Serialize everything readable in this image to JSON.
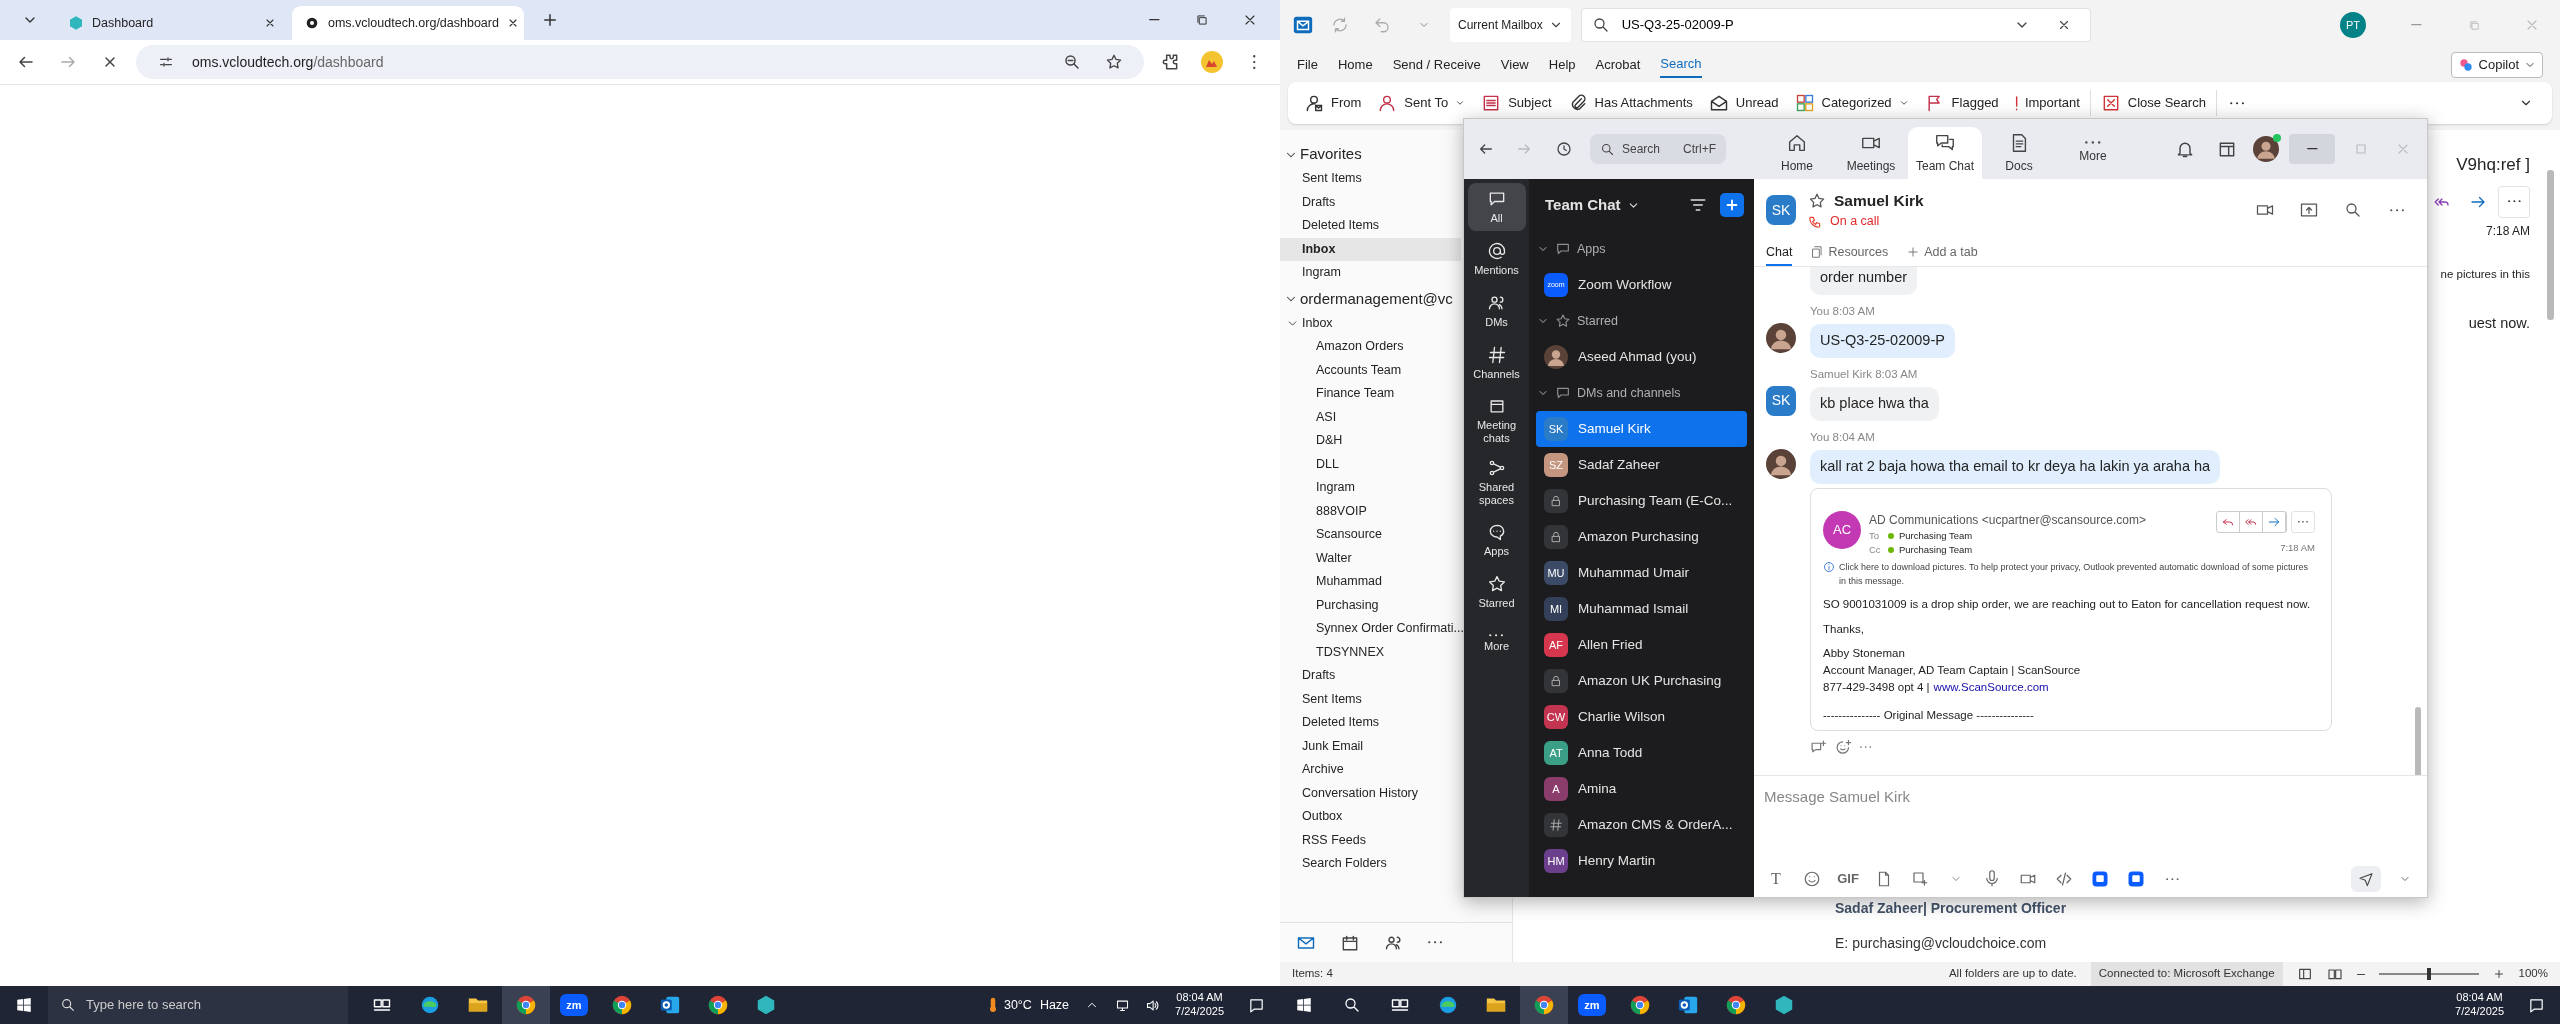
{
  "chrome": {
    "tabs": [
      {
        "title": "Dashboard",
        "kind": "app",
        "selected": false
      },
      {
        "title": "oms.vcloudtech.org/dashboard",
        "kind": "site",
        "selected": true
      }
    ],
    "url_host": "oms.vcloudtech.org",
    "url_path": "/dashboard"
  },
  "outlook": {
    "scope": "Current Mailbox",
    "search_value": "US-Q3-25-02009-P",
    "avatar": "PT",
    "menu": [
      {
        "label": "File",
        "selected": false
      },
      {
        "label": "Home",
        "selected": false
      },
      {
        "label": "Send / Receive",
        "selected": false
      },
      {
        "label": "View",
        "selected": false
      },
      {
        "label": "Help",
        "selected": false
      },
      {
        "label": "Acrobat",
        "selected": false
      },
      {
        "label": "Search",
        "selected": true
      }
    ],
    "copilot": "Copilot",
    "ribbon": [
      {
        "kind": "from",
        "label": "From",
        "dropdown": false
      },
      {
        "kind": "sent-to",
        "label": "Sent To",
        "dropdown": true
      },
      {
        "kind": "subject",
        "label": "Subject",
        "dropdown": false
      },
      {
        "kind": "attachments",
        "label": "Has Attachments",
        "dropdown": false
      },
      {
        "kind": "unread",
        "label": "Unread",
        "dropdown": false
      },
      {
        "kind": "categorized",
        "label": "Categorized",
        "dropdown": true
      },
      {
        "kind": "flagged",
        "label": "Flagged",
        "dropdown": false
      },
      {
        "kind": "important",
        "label": "Important",
        "dropdown": false
      },
      {
        "kind": "close-search",
        "label": "Close Search",
        "dropdown": false
      }
    ],
    "folders": [
      {
        "label": "Favorites",
        "expanded": true,
        "children": [
          {
            "label": "Sent Items",
            "selected": false
          },
          {
            "label": "Drafts",
            "selected": false
          },
          {
            "label": "Deleted Items",
            "selected": false
          },
          {
            "label": "Inbox",
            "selected": true
          },
          {
            "label": "Ingram",
            "selected": false
          }
        ]
      },
      {
        "label": "ordermanagement@vc",
        "expanded": true,
        "children": [
          {
            "label": "Inbox",
            "selected": false,
            "expanded": true,
            "children": [
              {
                "label": "Amazon Orders",
                "selected": false
              },
              {
                "label": "Accounts Team",
                "selected": false
              },
              {
                "label": "Finance Team",
                "selected": false
              },
              {
                "label": "ASI",
                "selected": false
              },
              {
                "label": "D&H",
                "selected": false
              },
              {
                "label": "DLL",
                "selected": false
              },
              {
                "label": "Ingram",
                "selected": false
              },
              {
                "label": "888VOIP",
                "selected": false
              },
              {
                "label": "Scansource",
                "selected": false
              },
              {
                "label": "Walter",
                "selected": false
              },
              {
                "label": "Muhammad",
                "selected": false
              },
              {
                "label": "Purchasing",
                "selected": false
              },
              {
                "label": "Synnex Order Confirmati...",
                "selected": false
              },
              {
                "label": "TDSYNNEX",
                "selected": false
              }
            ]
          },
          {
            "label": "Drafts",
            "selected": false
          },
          {
            "label": "Sent Items",
            "selected": false
          },
          {
            "label": "Deleted Items",
            "selected": false
          },
          {
            "label": "Junk Email",
            "selected": false
          },
          {
            "label": "Archive",
            "selected": false
          },
          {
            "label": "Conversation History",
            "selected": false
          },
          {
            "label": "Outbox",
            "selected": false
          },
          {
            "label": "RSS Feeds",
            "selected": false
          },
          {
            "label": "Search Folders",
            "selected": false
          }
        ]
      }
    ],
    "reading_pane": {
      "subject_tail": "V9hq:ref ]",
      "time": "7:18 AM",
      "notice_tail": "ne pictures in this",
      "body_tail": "uest now.",
      "signature": "Sadaf Zaheer| Procurement Officer",
      "email_label": "E:",
      "email": "purchasing@vcloudchoice.com"
    },
    "status": {
      "items": "Items: 4",
      "sync": "All folders are up to date.",
      "connection": "Connected to: Microsoft Exchange",
      "zoom_slider": {
        "level": 0.5,
        "reading": "100%"
      }
    }
  },
  "zoom": {
    "search": {
      "placeholder": "Search",
      "shortcut": "Ctrl+F"
    },
    "nav": [
      {
        "kind": "home",
        "label": "Home",
        "selected": false
      },
      {
        "kind": "meetings",
        "label": "Meetings",
        "selected": false
      },
      {
        "kind": "chat",
        "label": "Team Chat",
        "selected": true
      },
      {
        "kind": "docs",
        "label": "Docs",
        "selected": false
      },
      {
        "kind": "more",
        "label": "More",
        "selected": false
      }
    ],
    "rail": [
      {
        "kind": "all",
        "label": "All",
        "selected": true
      },
      {
        "kind": "mentions",
        "label": "Mentions",
        "selected": false
      },
      {
        "kind": "dms",
        "label": "DMs",
        "selected": false
      },
      {
        "kind": "channels",
        "label": "Channels",
        "selected": false
      },
      {
        "kind": "meeting-chats",
        "label": "Meeting chats",
        "selected": false
      },
      {
        "kind": "shared",
        "label": "Shared spaces",
        "selected": false
      },
      {
        "kind": "apps",
        "label": "Apps",
        "selected": false
      },
      {
        "kind": "starred",
        "label": "Starred",
        "selected": false
      },
      {
        "kind": "more",
        "label": "More",
        "selected": false
      }
    ],
    "panel_title": "Team Chat",
    "sections": [
      {
        "kind": "apps",
        "label": "Apps",
        "expanded": true,
        "items": [
          {
            "kind": "app",
            "name": "Zoom Workflow",
            "initials": "zoom",
            "selected": false
          }
        ]
      },
      {
        "kind": "starred",
        "label": "Starred",
        "expanded": true,
        "items": [
          {
            "kind": "photo",
            "name": "Aseed Ahmad (you)",
            "selected": false
          }
        ]
      },
      {
        "kind": "dms",
        "label": "DMs and channels",
        "expanded": true,
        "items": [
          {
            "kind": "initials",
            "name": "Samuel Kirk",
            "initials": "SK",
            "color": "#2a7bc8",
            "selected": true
          },
          {
            "kind": "initials",
            "name": "Sadaf Zaheer",
            "initials": "SZ",
            "color": "#c4957f",
            "selected": false
          },
          {
            "kind": "private",
            "name": "Purchasing Team (E-Co...",
            "selected": false
          },
          {
            "kind": "private",
            "name": "Amazon Purchasing",
            "selected": false
          },
          {
            "kind": "initials",
            "name": "Muhammad Umair",
            "initials": "MU",
            "color": "#3b4a66",
            "selected": false
          },
          {
            "kind": "initials",
            "name": "Muhammad Ismail",
            "initials": "MI",
            "color": "#34405a",
            "selected": false
          },
          {
            "kind": "initials",
            "name": "Allen Fried",
            "initials": "AF",
            "color": "#d6374e",
            "selected": false
          },
          {
            "kind": "private",
            "name": "Amazon UK Purchasing",
            "selected": false
          },
          {
            "kind": "initials",
            "name": "Charlie Wilson",
            "initials": "CW",
            "color": "#c2344f",
            "selected": false
          },
          {
            "kind": "initials",
            "name": "Anna Todd",
            "initials": "AT",
            "color": "#3b9e86",
            "selected": false
          },
          {
            "kind": "initials",
            "name": "Amina",
            "initials": "A",
            "color": "#8a3d6b",
            "selected": false
          },
          {
            "kind": "channel",
            "name": "Amazon CMS & OrderA...",
            "selected": false
          },
          {
            "kind": "initials",
            "name": "Henry Martin",
            "initials": "HM",
            "color": "#6b3f8c",
            "selected": false
          }
        ]
      }
    ],
    "chat": {
      "name": "Samuel Kirk",
      "initials": "SK",
      "status": "On a call",
      "tabs": [
        {
          "kind": "chat",
          "label": "Chat",
          "selected": true
        },
        {
          "kind": "resources",
          "label": "Resources",
          "selected": false
        },
        {
          "kind": "add",
          "label": "Add a tab",
          "selected": false
        }
      ],
      "messages": [
        {
          "kind": "continued",
          "mine": false,
          "text": "order number"
        },
        {
          "kind": "text",
          "mine": true,
          "meta": "You 8:03 AM",
          "text": "US-Q3-25-02009-P"
        },
        {
          "kind": "text",
          "mine": false,
          "initials": "SK",
          "meta": "Samuel Kirk 8:03 AM",
          "text": "kb place hwa tha"
        },
        {
          "kind": "text",
          "mine": true,
          "meta": "You 8:04 AM",
          "text": "kall rat 2 baja howa tha email to kr deya ha lakin ya araha ha",
          "attachment": {
            "initials": "AC",
            "from": "AD Communications <ucpartner@scansource.com>",
            "to_label": "To",
            "to": "Purchasing Team",
            "cc_label": "Cc",
            "cc": "Purchasing Team",
            "time": "7:18 AM",
            "notice": "Click here to download pictures. To help protect your privacy, Outlook prevented automatic download of some pictures in this message.",
            "body": [
              "SO 9001031009 is a drop ship order, we are reaching out to Eaton for cancellation request now.",
              "Thanks,"
            ],
            "signature": [
              "Abby Stoneman",
              "Account Manager, AD Team Captain | ScanSource"
            ],
            "phone": "877-429-3498 opt 4 |",
            "link": "www.ScanSource.com",
            "divider": "--------------- Original Message ---------------"
          }
        }
      ],
      "composer_placeholder": "Message Samuel Kirk",
      "toolbar": [
        {
          "kind": "format",
          "label": "T"
        },
        {
          "kind": "emoji"
        },
        {
          "kind": "gif",
          "label": "GIF"
        },
        {
          "kind": "file"
        },
        {
          "kind": "screenshot"
        },
        {
          "kind": "caret"
        },
        {
          "kind": "mic"
        },
        {
          "kind": "video"
        },
        {
          "kind": "code"
        },
        {
          "kind": "app-a"
        },
        {
          "kind": "app-b"
        },
        {
          "kind": "more"
        }
      ]
    }
  },
  "taskbars": [
    {
      "search_placeholder": "Type here to search",
      "apps": [
        {
          "kind": "task-view",
          "selected": false
        },
        {
          "kind": "edge",
          "selected": false
        },
        {
          "kind": "explorer",
          "selected": false
        },
        {
          "kind": "chrome",
          "selected": true
        },
        {
          "kind": "zoom",
          "label": "zm",
          "selected": false
        },
        {
          "kind": "chrome",
          "selected": false
        },
        {
          "kind": "outlook",
          "selected": false
        },
        {
          "kind": "chrome",
          "selected": false
        },
        {
          "kind": "app",
          "selected": false
        }
      ],
      "weather": {
        "temp": "30°C",
        "condition": "Haze"
      },
      "time": "08:04 AM",
      "date": "7/24/2025"
    },
    {
      "apps": [
        {
          "kind": "task-view",
          "selected": false
        },
        {
          "kind": "edge",
          "selected": false
        },
        {
          "kind": "explorer",
          "selected": false
        },
        {
          "kind": "chrome",
          "selected": true
        },
        {
          "kind": "zoom",
          "label": "zm",
          "selected": false
        },
        {
          "kind": "chrome",
          "selected": false
        },
        {
          "kind": "outlook",
          "selected": false
        },
        {
          "kind": "chrome",
          "selected": false
        },
        {
          "kind": "app",
          "selected": false
        }
      ],
      "time": "08:04 AM",
      "date": "7/24/2025"
    }
  ]
}
